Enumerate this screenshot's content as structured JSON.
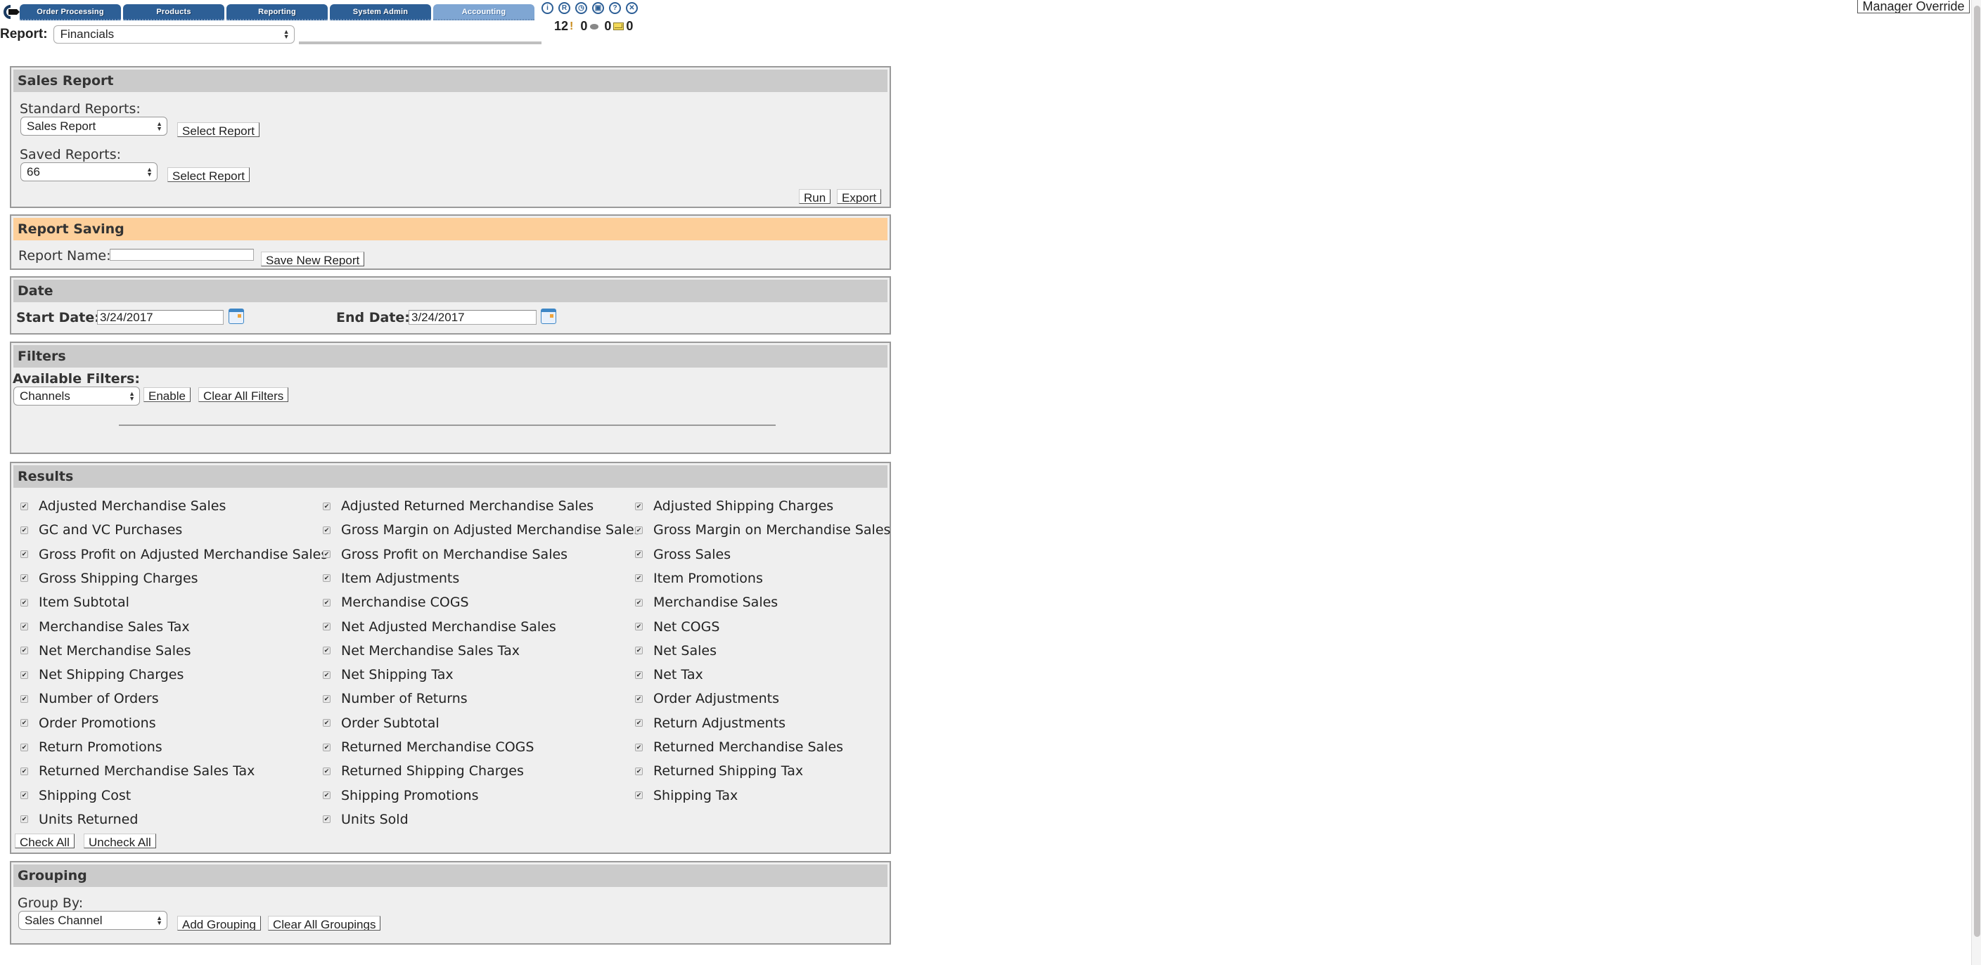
{
  "nav": {
    "tabs": [
      {
        "label": "Order Processing",
        "active": false
      },
      {
        "label": "Products",
        "active": false
      },
      {
        "label": "Reporting",
        "active": false
      },
      {
        "label": "System Admin",
        "active": false
      },
      {
        "label": "Accounting",
        "active": true
      }
    ],
    "icons": [
      {
        "name": "user-info-icon",
        "glyph": "i"
      },
      {
        "name": "registered-icon",
        "glyph": "R"
      },
      {
        "name": "clock-icon",
        "glyph": "◷"
      },
      {
        "name": "window-icon",
        "glyph": "▣"
      },
      {
        "name": "help-icon",
        "glyph": "?"
      },
      {
        "name": "close-icon",
        "glyph": "✕"
      }
    ],
    "counters": {
      "alerts": "12",
      "alert_glyph": "!",
      "messages": "0",
      "mail_before": "0",
      "mail_after": "0"
    },
    "manager_override_label": "Manager Override"
  },
  "report_selector": {
    "label": "Report:",
    "value": "Financials"
  },
  "sales_report": {
    "title": "Sales Report",
    "standard_label": "Standard Reports:",
    "standard_value": "Sales Report",
    "select_report_label": "Select Report",
    "saved_label": "Saved Reports:",
    "saved_value": "66",
    "run_label": "Run",
    "export_label": "Export"
  },
  "report_saving": {
    "title": "Report Saving",
    "name_label": "Report Name:",
    "name_value": "",
    "save_label": "Save New Report",
    "accent_color": "#fdcf9a"
  },
  "date": {
    "title": "Date",
    "start_label": "Start Date:",
    "start_value": "3/24/2017",
    "end_label": "End Date:",
    "end_value": "3/24/2017"
  },
  "filters": {
    "title": "Filters",
    "available_label": "Available Filters:",
    "selected": "Channels",
    "enable_label": "Enable",
    "clear_label": "Clear All Filters"
  },
  "results": {
    "title": "Results",
    "columns": [
      [
        {
          "label": "Adjusted Merchandise Sales",
          "checked": true
        },
        {
          "label": "GC and VC Purchases",
          "checked": true
        },
        {
          "label": "Gross Profit on Adjusted Merchandise Sales",
          "checked": true
        },
        {
          "label": "Gross Shipping Charges",
          "checked": true
        },
        {
          "label": "Item Subtotal",
          "checked": true
        },
        {
          "label": "Merchandise Sales Tax",
          "checked": true
        },
        {
          "label": "Net Merchandise Sales",
          "checked": true
        },
        {
          "label": "Net Shipping Charges",
          "checked": true
        },
        {
          "label": "Number of Orders",
          "checked": true
        },
        {
          "label": "Order Promotions",
          "checked": true
        },
        {
          "label": "Return Promotions",
          "checked": true
        },
        {
          "label": "Returned Merchandise Sales Tax",
          "checked": true
        },
        {
          "label": "Shipping Cost",
          "checked": true
        },
        {
          "label": "Units Returned",
          "checked": true
        }
      ],
      [
        {
          "label": "Adjusted Returned Merchandise Sales",
          "checked": true
        },
        {
          "label": "Gross Margin on Adjusted Merchandise Sales",
          "checked": true
        },
        {
          "label": "Gross Profit on Merchandise Sales",
          "checked": true
        },
        {
          "label": "Item Adjustments",
          "checked": true
        },
        {
          "label": "Merchandise COGS",
          "checked": true
        },
        {
          "label": "Net Adjusted Merchandise Sales",
          "checked": true
        },
        {
          "label": "Net Merchandise Sales Tax",
          "checked": true
        },
        {
          "label": "Net Shipping Tax",
          "checked": true
        },
        {
          "label": "Number of Returns",
          "checked": true
        },
        {
          "label": "Order Subtotal",
          "checked": true
        },
        {
          "label": "Returned Merchandise COGS",
          "checked": true
        },
        {
          "label": "Returned Shipping Charges",
          "checked": true
        },
        {
          "label": "Shipping Promotions",
          "checked": true
        },
        {
          "label": "Units Sold",
          "checked": true
        }
      ],
      [
        {
          "label": "Adjusted Shipping Charges",
          "checked": true
        },
        {
          "label": "Gross Margin on Merchandise Sales",
          "checked": true
        },
        {
          "label": "Gross Sales",
          "checked": true
        },
        {
          "label": "Item Promotions",
          "checked": true
        },
        {
          "label": "Merchandise Sales",
          "checked": true
        },
        {
          "label": "Net COGS",
          "checked": true
        },
        {
          "label": "Net Sales",
          "checked": true
        },
        {
          "label": "Net Tax",
          "checked": true
        },
        {
          "label": "Order Adjustments",
          "checked": true
        },
        {
          "label": "Return Adjustments",
          "checked": true
        },
        {
          "label": "Returned Merchandise Sales",
          "checked": true
        },
        {
          "label": "Returned Shipping Tax",
          "checked": true
        },
        {
          "label": "Shipping Tax",
          "checked": true
        }
      ]
    ],
    "check_all_label": "Check All",
    "uncheck_all_label": "Uncheck All"
  },
  "grouping": {
    "title": "Grouping",
    "group_by_label": "Group By:",
    "selected": "Sales Channel",
    "add_label": "Add Grouping",
    "clear_label": "Clear All Groupings"
  },
  "colors": {
    "tab": "#2d5f96",
    "tab_active": "#7fa6d3",
    "panel_head": "#cbcbcb",
    "panel_bg": "#efefef"
  }
}
